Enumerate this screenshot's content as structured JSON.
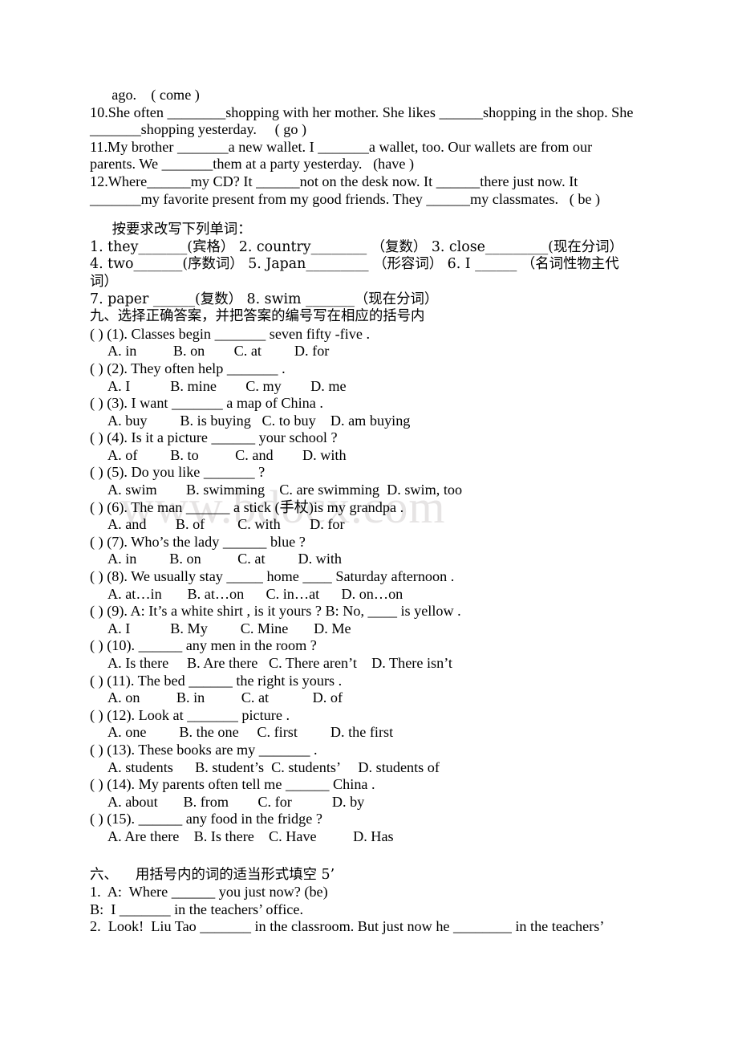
{
  "document": {
    "type": "english-exam-worksheet",
    "language_mix": "English with Simplified Chinese instructions",
    "watermark": "www.bdocx.com",
    "watermark_color": "#e6e4e4",
    "text_color": "#000000",
    "background_color": "#ffffff"
  },
  "fill_in_blanks_continued": {
    "line_carryover": "      ago.    ( come )",
    "items": [
      "10.She often ________shopping with her mother. She likes ______shopping in the shop. She",
      "_______shopping yesterday.     ( go )",
      "11.My brother _______a new wallet. I _______a wallet, too. Our wallets are from our",
      "parents. We _______them at a party yesterday.   (have )",
      "12.Where______my CD? It ______not on the desk now. It ______there just now. It",
      "_______my favorite present from my good friends. They ______my classmates.   ( be )"
    ]
  },
  "word_forms": {
    "heading": "     按要求改写下列单词：",
    "lines": [
      "1. they_______(宾格） 2. country________ （复数） 3. close_________(现在分词）",
      "4. two_______(序数词） 5. Japan_________ （形容词） 6. I ______ （名词性物主代",
      "词）",
      "7. paper ______(复数） 8. swim _______（现在分词）"
    ]
  },
  "multiple_choice": {
    "heading": "九、选择正确答案，并把答案的编号写在相应的括号内",
    "questions": [
      {
        "stem": "( ) (1). Classes begin _______ seven fifty -five .",
        "options": "A. in          B. on        C. at         D. for"
      },
      {
        "stem": "( ) (2). They often help _______ .",
        "options": "A. I           B. mine        C. my        D. me"
      },
      {
        "stem": "( ) (3). I want _______ a map of China .",
        "options": "A. buy         B. is buying   C. to buy    D. am buying"
      },
      {
        "stem": "( ) (4). Is it a picture ______ your school ?",
        "options": "A. of         B. to          C. and        D. with"
      },
      {
        "stem": "( ) (5). Do you like _______ ?",
        "options": "A. swim        B. swimming    C. are swimming  D. swim, too"
      },
      {
        "stem": "( ) (6). The man ______ a stick (手杖)is my grandpa .",
        "options": "A. and        B. of         C. with        D. for"
      },
      {
        "stem": "( ) (7). Who’s the lady ______ blue ?",
        "options": "A. in         B. on          C. at         D. with"
      },
      {
        "stem": "( ) (8). We usually stay _____ home ____ Saturday afternoon .",
        "options": "A. at…in       B. at…on      C. in…at      D. on…on"
      },
      {
        "stem": "( ) (9). A: It’s a white shirt , is it yours ? B: No, ____ is yellow .",
        "options": "A. I           B. My         C. Mine       D. Me"
      },
      {
        "stem": "( ) (10). ______ any men in the room ?",
        "options": "A. Is there     B. Are there   C. There aren’t    D. There isn’t"
      },
      {
        "stem": "( ) (11). The bed ______ the right is yours .",
        "options": "A. on          B. in          C. at            D. of"
      },
      {
        "stem": "( ) (12). Look at _______ picture .",
        "options": "A. one         B. the one     C. first         D. the first"
      },
      {
        "stem": "( ) (13). These books are my _______ .",
        "options": "A. students      B. student’s  C. students’     D. students of"
      },
      {
        "stem": "( ) (14). My parents often tell me ______ China .",
        "options": "A. about       B. from        C. for           D. by"
      },
      {
        "stem": "( ) (15). ______ any food in the fridge ?",
        "options": "A. Are there    B. Is there    C. Have          D. Has"
      }
    ]
  },
  "verb_forms_section": {
    "heading": "六、    用括号内的词的适当形式填空 5’",
    "lines": [
      "1.  A:  Where ______ you just now? (be)",
      "B:  I _______ in the teachers’ office.",
      "2.  Look!  Liu Tao _______ in the classroom. But just now he ________ in the teachers’"
    ]
  }
}
